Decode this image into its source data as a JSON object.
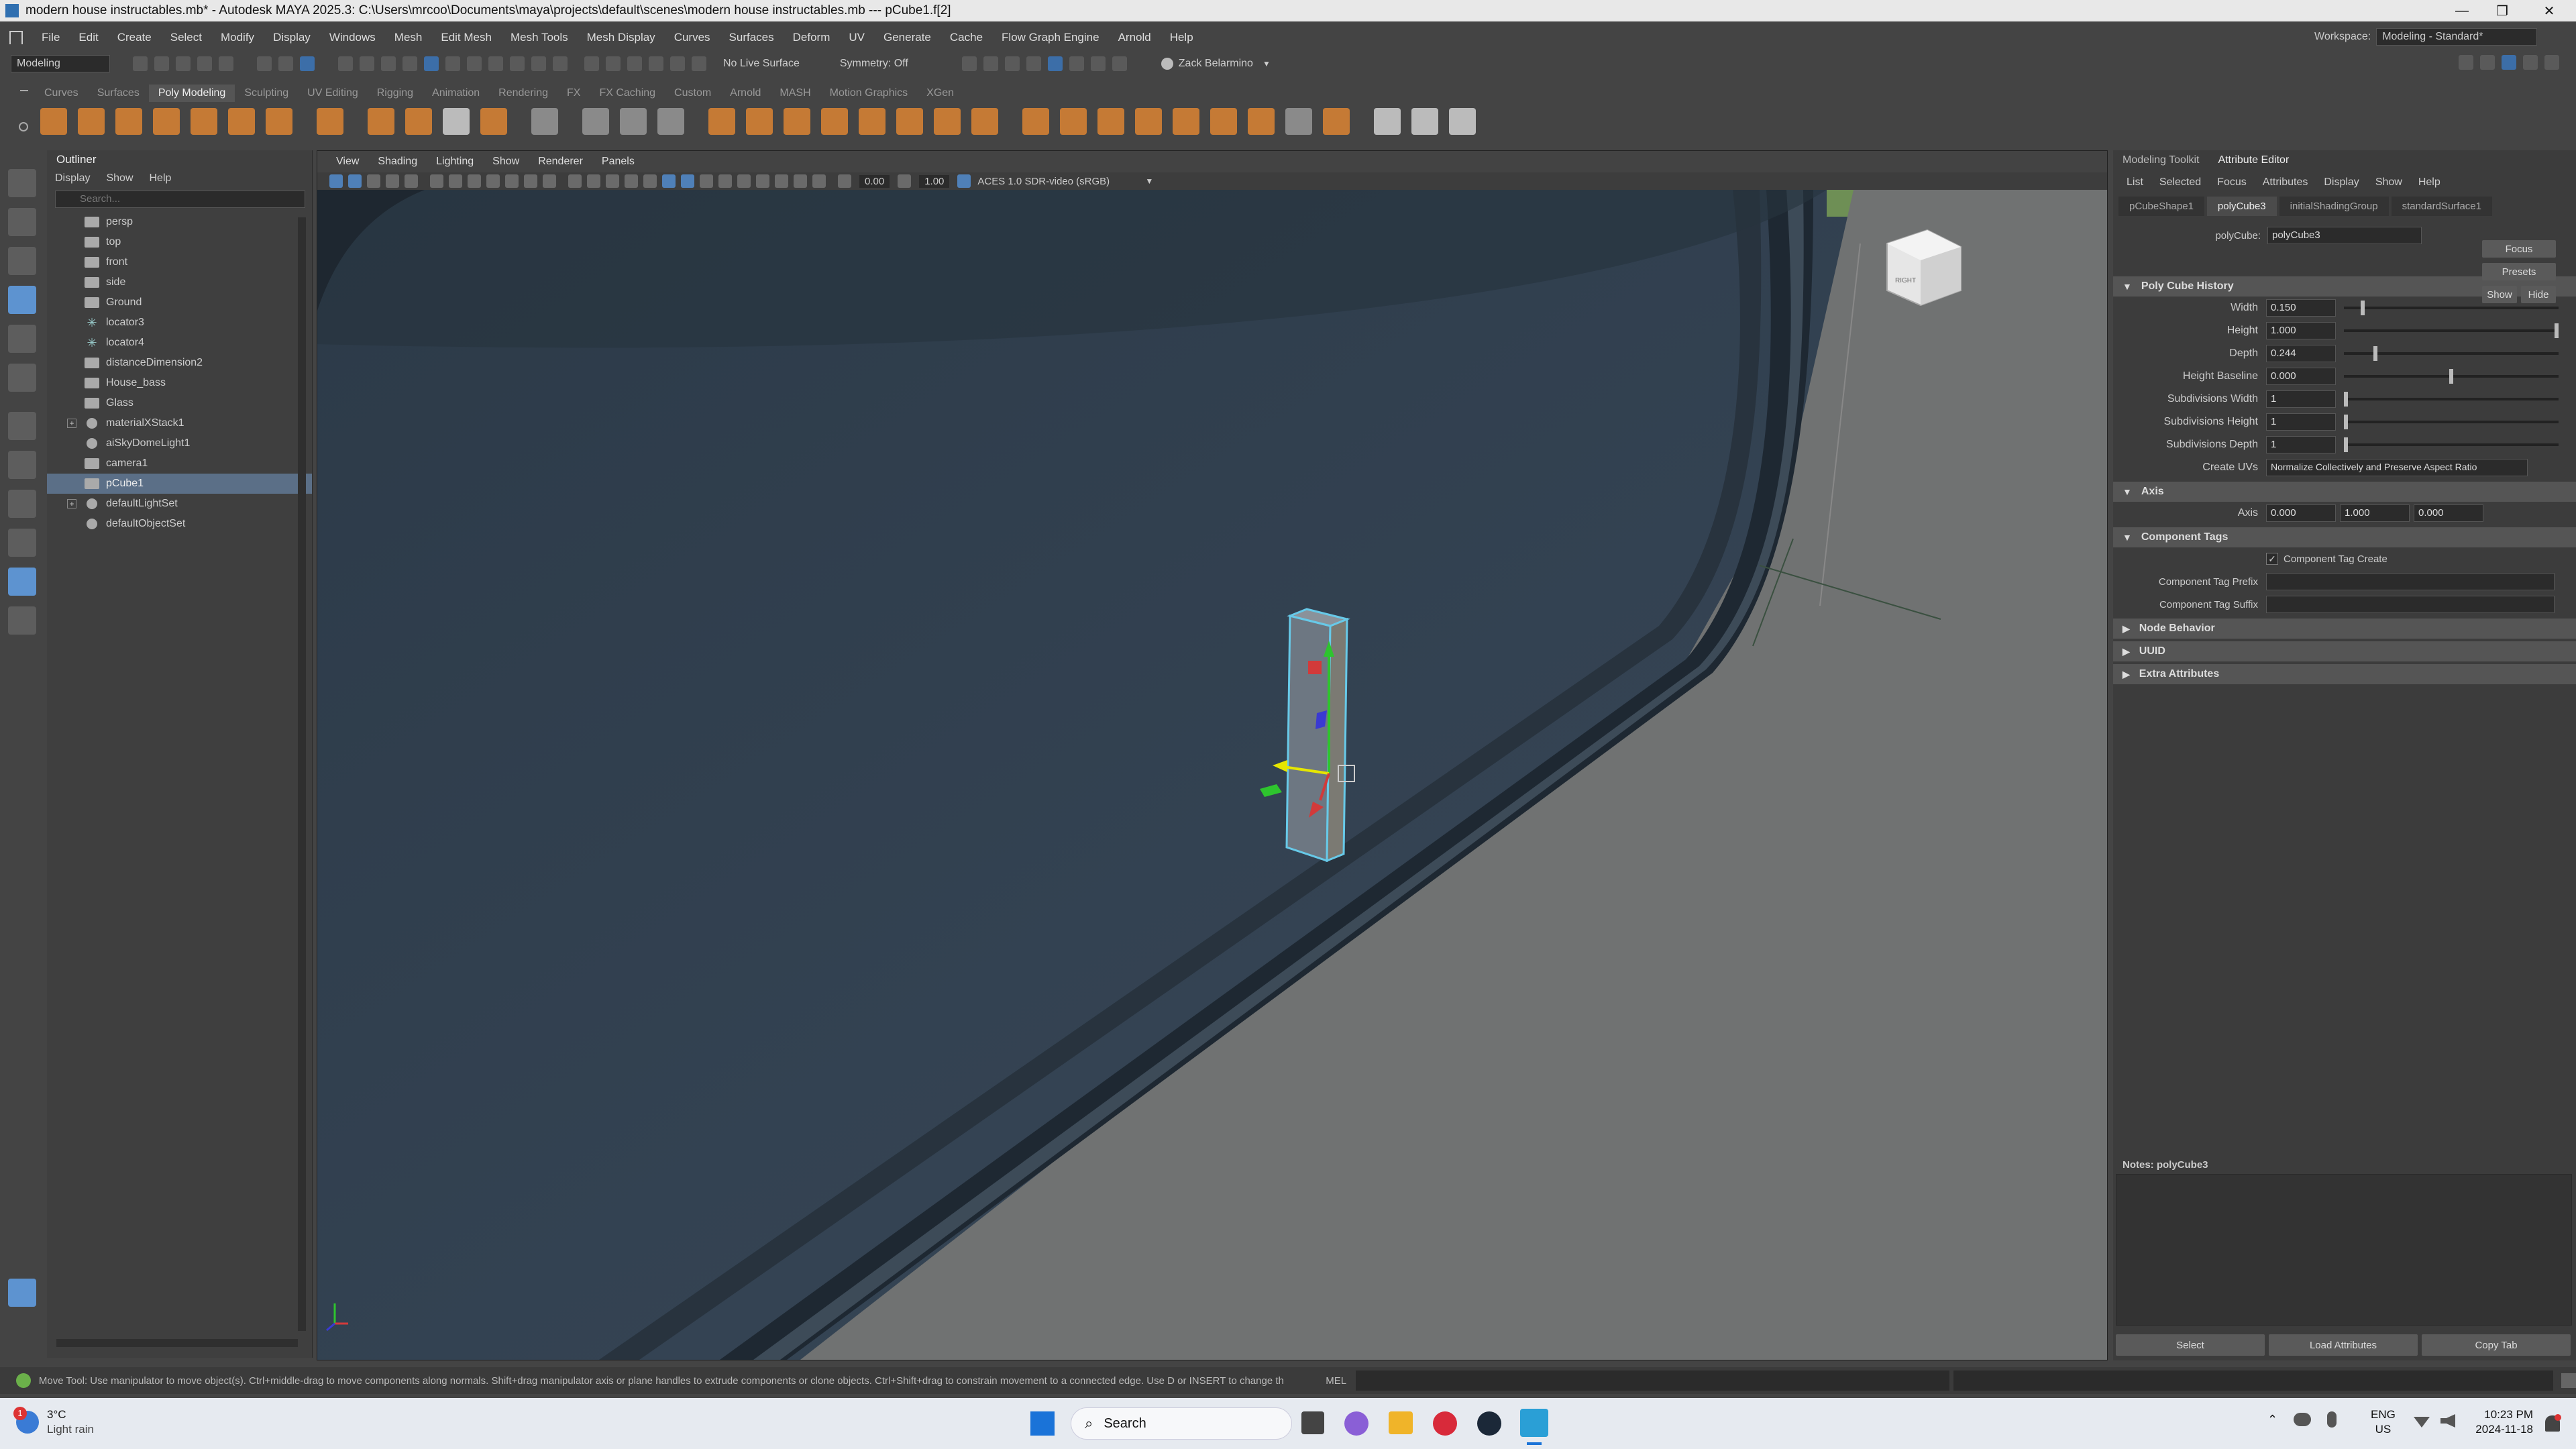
{
  "window": {
    "title": "modern house instructables.mb* - Autodesk MAYA 2025.3: C:\\Users\\mrcoo\\Documents\\maya\\projects\\default\\scenes\\modern house instructables.mb   ---   pCube1.f[2]",
    "minimize": "—",
    "maximize": "❐",
    "close": "✕"
  },
  "menubar": [
    "File",
    "Edit",
    "Create",
    "Select",
    "Modify",
    "Display",
    "Windows",
    "Mesh",
    "Edit Mesh",
    "Mesh Tools",
    "Mesh Display",
    "Curves",
    "Surfaces",
    "Deform",
    "UV",
    "Generate",
    "Cache",
    "Flow Graph Engine",
    "Arnold",
    "Help"
  ],
  "workspace": {
    "label": "Workspace:",
    "value": "Modeling - Standard*"
  },
  "toolbar": {
    "mode": "Modeling",
    "live_surface": "No Live Surface",
    "symmetry": "Symmetry: Off",
    "user": "Zack Belarmino"
  },
  "shelf_tabs": [
    "Curves",
    "Surfaces",
    "Poly Modeling",
    "Sculpting",
    "UV Editing",
    "Rigging",
    "Animation",
    "Rendering",
    "FX",
    "FX Caching",
    "Custom",
    "Arnold",
    "MASH",
    "Motion Graphics",
    "XGen"
  ],
  "shelf_active": "Poly Modeling",
  "outliner": {
    "title": "Outliner",
    "menu": [
      "Display",
      "Show",
      "Help"
    ],
    "search_placeholder": "Search...",
    "items": [
      {
        "label": "persp",
        "icon": "camera-icon"
      },
      {
        "label": "top",
        "icon": "camera-icon"
      },
      {
        "label": "front",
        "icon": "camera-icon"
      },
      {
        "label": "side",
        "icon": "camera-icon"
      },
      {
        "label": "Ground",
        "icon": "mesh-icon"
      },
      {
        "label": "locator3",
        "icon": "locator-icon"
      },
      {
        "label": "locator4",
        "icon": "locator-icon"
      },
      {
        "label": "distanceDimension2",
        "icon": "mesh-icon"
      },
      {
        "label": "House_bass",
        "icon": "mesh-icon"
      },
      {
        "label": "Glass",
        "icon": "mesh-icon"
      },
      {
        "label": "materialXStack1",
        "icon": "material-icon",
        "expand": "+"
      },
      {
        "label": "aiSkyDomeLight1",
        "icon": "light-icon"
      },
      {
        "label": "camera1",
        "icon": "camera-icon"
      },
      {
        "label": "pCube1",
        "icon": "mesh-icon",
        "selected": true
      },
      {
        "label": "defaultLightSet",
        "icon": "set-icon",
        "expand": "+"
      },
      {
        "label": "defaultObjectSet",
        "icon": "set-icon"
      }
    ]
  },
  "viewport": {
    "menu": [
      "View",
      "Shading",
      "Lighting",
      "Show",
      "Renderer",
      "Panels"
    ],
    "exposure": "0.00",
    "gamma": "1.00",
    "colorspace": "ACES 1.0 SDR-video (sRGB)",
    "viewcube_label": "RIGHT"
  },
  "attribute_editor": {
    "tabs": [
      "Modeling Toolkit",
      "Attribute Editor"
    ],
    "active_tab": "Attribute Editor",
    "menu": [
      "List",
      "Selected",
      "Focus",
      "Attributes",
      "Display",
      "Show",
      "Help"
    ],
    "node_tabs": [
      "pCubeShape1",
      "polyCube3",
      "initialShadingGroup",
      "standardSurface1"
    ],
    "active_node": "polyCube3",
    "node_label": "polyCube:",
    "node_name": "polyCube3",
    "buttons": {
      "focus": "Focus",
      "presets": "Presets",
      "show": "Show",
      "hide": "Hide"
    },
    "history_title": "Poly Cube History",
    "attrs": [
      {
        "label": "Width",
        "value": "0.150",
        "slider": 0.08
      },
      {
        "label": "Height",
        "value": "1.000",
        "slider": 1.0
      },
      {
        "label": "Depth",
        "value": "0.244",
        "slider": 0.14
      },
      {
        "label": "Height Baseline",
        "value": "0.000",
        "slider": 0.5
      },
      {
        "label": "Subdivisions Width",
        "value": "1",
        "slider": 0.0
      },
      {
        "label": "Subdivisions Height",
        "value": "1",
        "slider": 0.0
      },
      {
        "label": "Subdivisions Depth",
        "value": "1",
        "slider": 0.0
      }
    ],
    "create_uvs_label": "Create UVs",
    "create_uvs_value": "Normalize Collectively and Preserve Aspect Ratio",
    "axis_title": "Axis",
    "axis_label": "Axis",
    "axis": [
      "0.000",
      "1.000",
      "0.000"
    ],
    "component_tags_title": "Component Tags",
    "component_tag_create": "Component Tag Create",
    "component_tag_prefix": "Component Tag Prefix",
    "component_tag_suffix": "Component Tag Suffix",
    "node_behavior": "Node Behavior",
    "uuid": "UUID",
    "extra_attributes": "Extra Attributes",
    "notes": "Notes:  polyCube3",
    "bottom_buttons": [
      "Select",
      "Load Attributes",
      "Copy Tab"
    ]
  },
  "statusline": {
    "help": "Move Tool: Use manipulator to move object(s). Ctrl+middle-drag to move components along normals. Shift+drag manipulator axis or plane handles to extrude components or clone objects. Ctrl+Shift+drag to constrain movement to a connected edge. Use D or INSERT to change th",
    "mel": "MEL"
  },
  "taskbar": {
    "weather_temp": "3°C",
    "weather_desc": "Light rain",
    "weather_badge": "1",
    "search": "Search",
    "lang1": "ENG",
    "lang2": "US",
    "time": "10:23 PM",
    "date": "2024-11-18"
  },
  "colors": {
    "accent": "#5d93d0",
    "shelf_icon": "#c57a35",
    "selection": "#5b6f87"
  }
}
